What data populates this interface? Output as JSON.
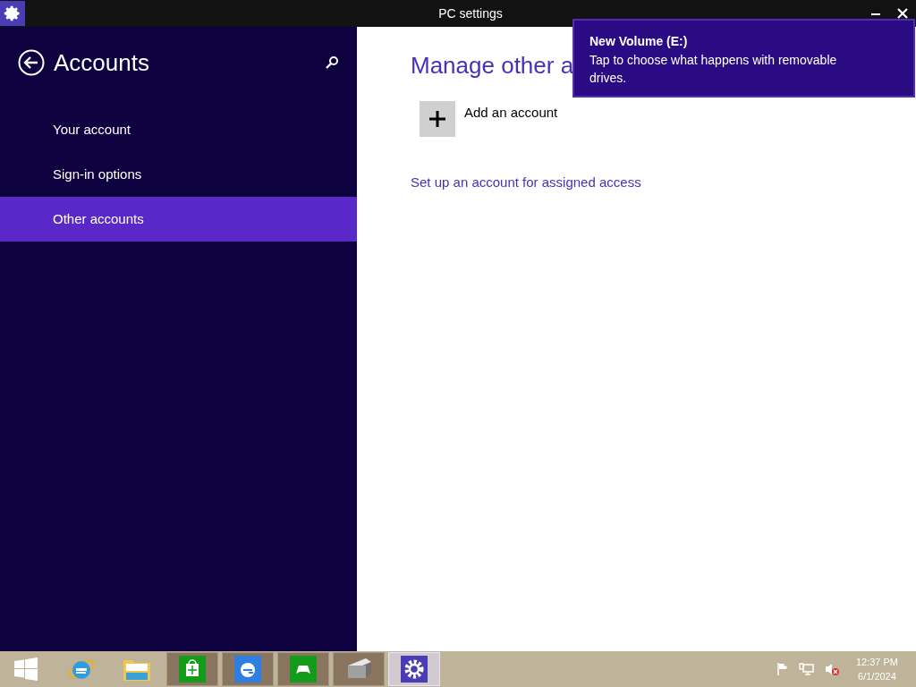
{
  "window": {
    "title": "PC settings"
  },
  "sidebar": {
    "title": "Accounts",
    "items": [
      {
        "label": "Your account",
        "selected": false
      },
      {
        "label": "Sign-in options",
        "selected": false
      },
      {
        "label": "Other accounts",
        "selected": true
      }
    ]
  },
  "content": {
    "heading": "Manage other a",
    "add_button": {
      "label": "Add an account"
    },
    "link": "Set up an account for assigned access"
  },
  "toast": {
    "title": "New Volume (E:)",
    "message": "Tap to choose what happens with removable drives."
  },
  "taskbar": {
    "items": [
      {
        "kind": "start",
        "open": false,
        "selected": false
      },
      {
        "kind": "ie",
        "open": false,
        "selected": false
      },
      {
        "kind": "explorer",
        "open": false,
        "selected": false
      },
      {
        "kind": "store",
        "open": true,
        "selected": false
      },
      {
        "kind": "ie-modern",
        "open": true,
        "selected": false
      },
      {
        "kind": "games",
        "open": true,
        "selected": false
      },
      {
        "kind": "device",
        "open": true,
        "selected": false
      },
      {
        "kind": "settings",
        "open": true,
        "selected": true
      }
    ],
    "time": "12:37 PM",
    "date": "6/1/2024"
  }
}
